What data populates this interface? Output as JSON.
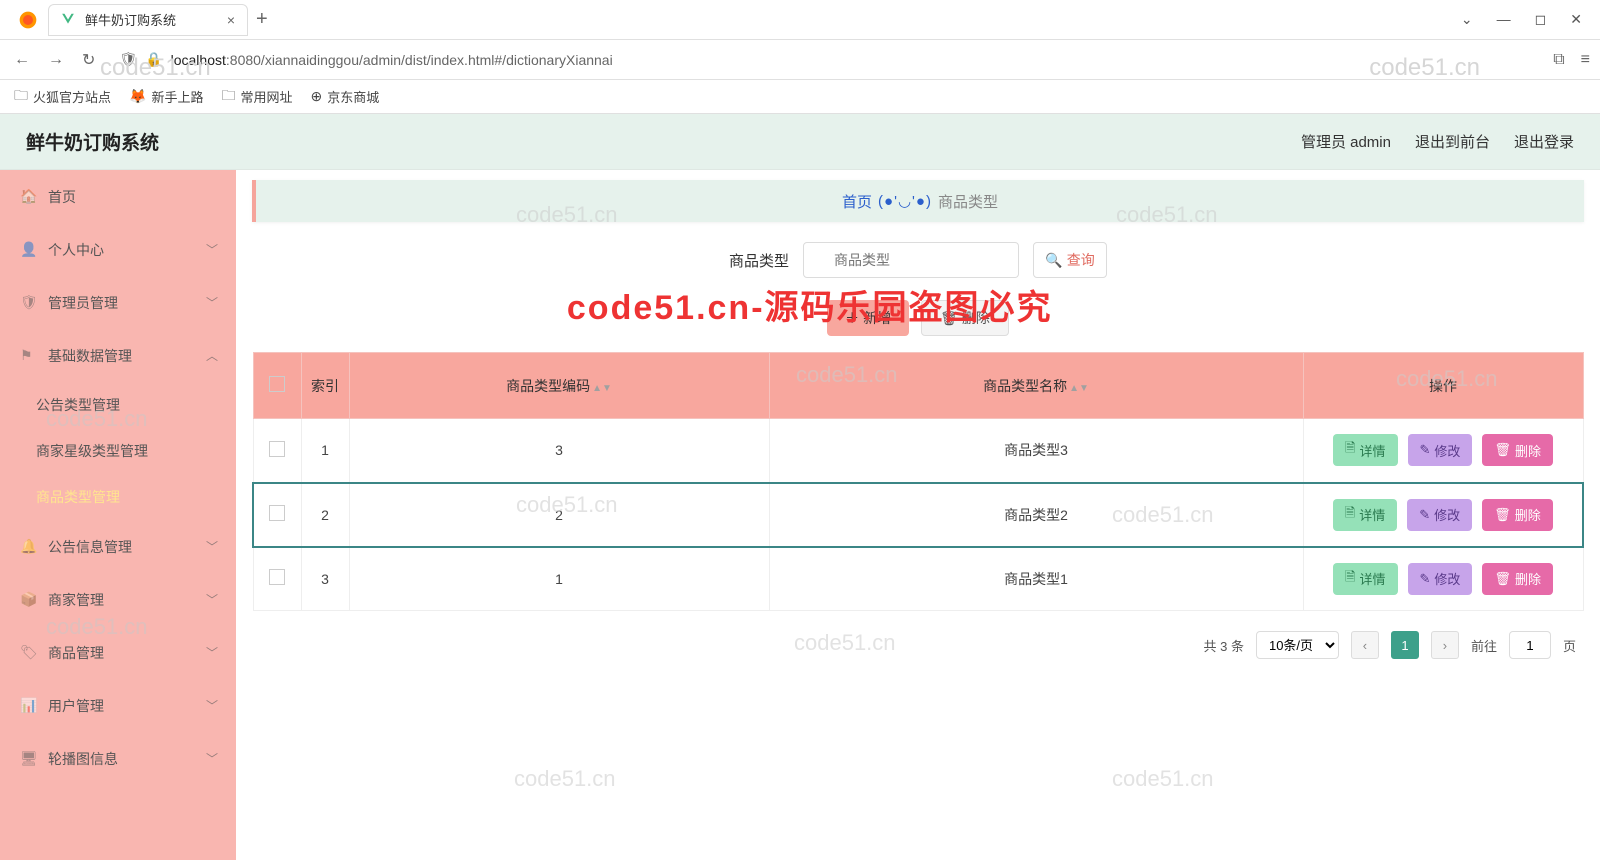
{
  "browser": {
    "tab_title": "鲜牛奶订购系统",
    "url_prefix": "localhost",
    "url_rest": ":8080/xiannaidinggou/admin/dist/index.html#/dictionaryXiannai"
  },
  "bookmarks": [
    {
      "label": "火狐官方站点"
    },
    {
      "label": "新手上路"
    },
    {
      "label": "常用网址"
    },
    {
      "label": "京东商城"
    }
  ],
  "header": {
    "title": "鲜牛奶订购系统",
    "user_label": "管理员 admin",
    "exit_front": "退出到前台",
    "logout": "退出登录"
  },
  "sidebar": {
    "items": [
      {
        "icon": "🏠",
        "label": "首页",
        "chev": ""
      },
      {
        "icon": "👤",
        "label": "个人中心",
        "chev": "﹀"
      },
      {
        "icon": "🛡",
        "label": "管理员管理",
        "chev": "﹀"
      },
      {
        "icon": "⚑",
        "label": "基础数据管理",
        "chev": "︿",
        "subs": [
          {
            "label": "公告类型管理"
          },
          {
            "label": "商家星级类型管理"
          },
          {
            "label": "商品类型管理",
            "active": true
          }
        ]
      },
      {
        "icon": "🔔",
        "label": "公告信息管理",
        "chev": "﹀"
      },
      {
        "icon": "📦",
        "label": "商家管理",
        "chev": "﹀"
      },
      {
        "icon": "🏷",
        "label": "商品管理",
        "chev": "﹀"
      },
      {
        "icon": "📊",
        "label": "用户管理",
        "chev": "﹀"
      },
      {
        "icon": "🖥",
        "label": "轮播图信息",
        "chev": "﹀"
      }
    ]
  },
  "breadcrumb": {
    "home": "首页",
    "face": "(●'◡'●)",
    "current": "商品类型"
  },
  "search": {
    "label": "商品类型",
    "placeholder": "商品类型",
    "query_btn": "查询"
  },
  "actions": {
    "add": "新增",
    "del": "删除"
  },
  "table": {
    "headers": {
      "idx": "索引",
      "code": "商品类型编码",
      "name": "商品类型名称",
      "ops": "操作"
    },
    "rows": [
      {
        "idx": "1",
        "code": "3",
        "name": "商品类型3"
      },
      {
        "idx": "2",
        "code": "2",
        "name": "商品类型2",
        "selected": true
      },
      {
        "idx": "3",
        "code": "1",
        "name": "商品类型1"
      }
    ],
    "op_labels": {
      "detail": "详情",
      "edit": "修改",
      "del": "删除"
    }
  },
  "pagination": {
    "total": "共 3 条",
    "page_size": "10条/页",
    "goto_prefix": "前往",
    "goto_suffix": "页",
    "page_current": "1"
  },
  "watermark": "code51.cn",
  "watermark_red": "code51.cn-源码乐园盗图必究"
}
